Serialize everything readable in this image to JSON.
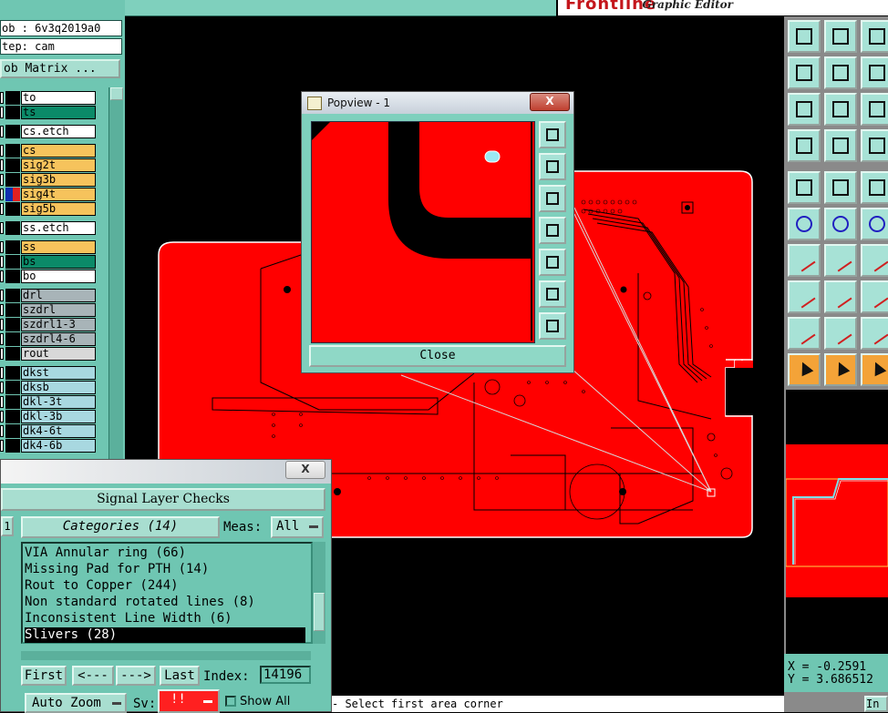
{
  "left_panel": {
    "job_label": "ob : 6v3q2019a0",
    "step_label": "tep: cam",
    "job_matrix_button": "ob Matrix ...",
    "layers": [
      {
        "name": "to",
        "color": "#ffffff"
      },
      {
        "name": "ts",
        "color": "#0b8a68"
      },
      {
        "name": "cs.etch",
        "color": "#ffffff"
      },
      {
        "name": "cs",
        "color": "#f6c35c"
      },
      {
        "name": "sig2t",
        "color": "#f6c35c"
      },
      {
        "name": "sig3b",
        "color": "#f6c35c"
      },
      {
        "name": "sig4t",
        "color": "#f6c35c"
      },
      {
        "name": "sig5b",
        "color": "#f6c35c"
      },
      {
        "name": "ss.etch",
        "color": "#ffffff"
      },
      {
        "name": "ss",
        "color": "#f6c35c"
      },
      {
        "name": "bs",
        "color": "#0b8a68"
      },
      {
        "name": "bo",
        "color": "#ffffff"
      },
      {
        "name": "drl",
        "color": "#a8b4b8"
      },
      {
        "name": "szdrl",
        "color": "#a8b4b8"
      },
      {
        "name": "szdrl1-3",
        "color": "#a8b4b8"
      },
      {
        "name": "szdrl4-6",
        "color": "#a8b4b8"
      },
      {
        "name": "rout",
        "color": "#d8d8d8"
      },
      {
        "name": "dkst",
        "color": "#a8d8e0"
      },
      {
        "name": "dksb",
        "color": "#a8d8e0"
      },
      {
        "name": "dkl-3t",
        "color": "#a8d8e0"
      },
      {
        "name": "dkl-3b",
        "color": "#a8d8e0"
      },
      {
        "name": "dk4-6t",
        "color": "#a8d8e0"
      },
      {
        "name": "dk4-6b",
        "color": "#a8d8e0"
      }
    ]
  },
  "header": {
    "brand_logo": "Frontline",
    "brand_text": "Graphic Editor"
  },
  "popview": {
    "title": "Popview - 1",
    "close_x": "X",
    "close_button": "Close"
  },
  "signal_layer_checks": {
    "title_close": "X",
    "header": "Signal Layer Checks",
    "left_tab": "1",
    "categories_button": "Categories (14)",
    "meas_label": "Meas:",
    "meas_value": "All",
    "categories": [
      "VIA Annular ring (66)",
      "Missing Pad for PTH (14)",
      "Rout to Copper (244)",
      "Non standard rotated lines (8)",
      "Inconsistent Line Width (6)",
      "Slivers (28)"
    ],
    "selected_index": 5,
    "nav": {
      "first": "First",
      "prev": "<---",
      "next": "--->",
      "last": "Last",
      "index_label": "Index:",
      "index_value": "14196"
    },
    "auto_zoom": "Auto Zoom",
    "sv_label": "Sv:",
    "sv_value": "!!",
    "show_all": "Show All"
  },
  "coords": {
    "x": "X = -0.2591",
    "y": "Y = 3.686512"
  },
  "status": {
    "prompt": "- Select first area corner",
    "right_label": "In"
  },
  "colors": {
    "panel_teal": "#6fc6b2",
    "board_red": "#ff0000",
    "accent_orange": "#f4a338"
  }
}
